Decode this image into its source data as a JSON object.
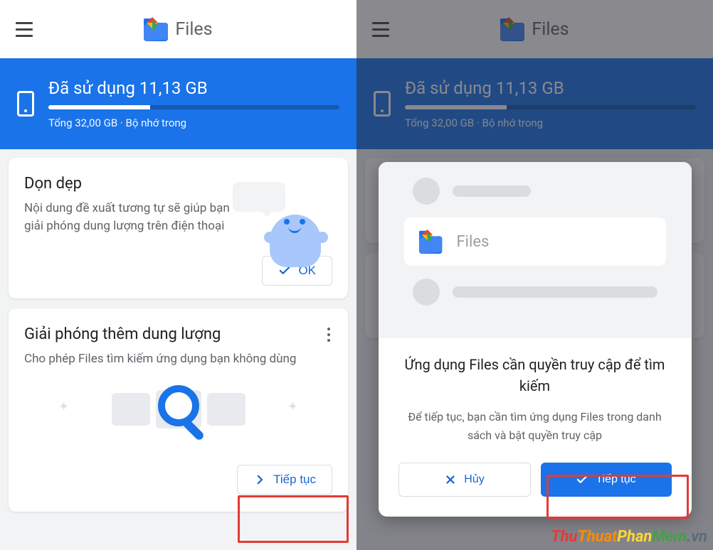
{
  "header": {
    "app_name": "Files"
  },
  "storage": {
    "used_label": "Đã sử dụng 11,13 GB",
    "total_label": "Tổng 32,00 GB · Bộ nhớ trong",
    "used_percent": 35
  },
  "card_clean": {
    "title": "Dọn dẹp",
    "text": "Nội dung đề xuất tương tự sẽ giúp bạn giải phóng dung lượng trên điện thoại",
    "ok_label": "OK"
  },
  "card_free": {
    "title": "Giải phóng thêm dung lượng",
    "text": "Cho phép Files tìm kiếm ứng dụng bạn không dùng",
    "continue_label": "Tiếp tục"
  },
  "modal": {
    "hero_app_label": "Files",
    "title": "Ứng dụng Files cần quyền truy cập để tìm kiếm",
    "text": "Để tiếp tục, bạn cần tìm ứng dụng Files trong danh sách và bật quyền truy cập",
    "cancel_label": "Hủy",
    "continue_label": "Tiếp tục"
  },
  "watermark": "ThuThuatPhanMem.vn"
}
